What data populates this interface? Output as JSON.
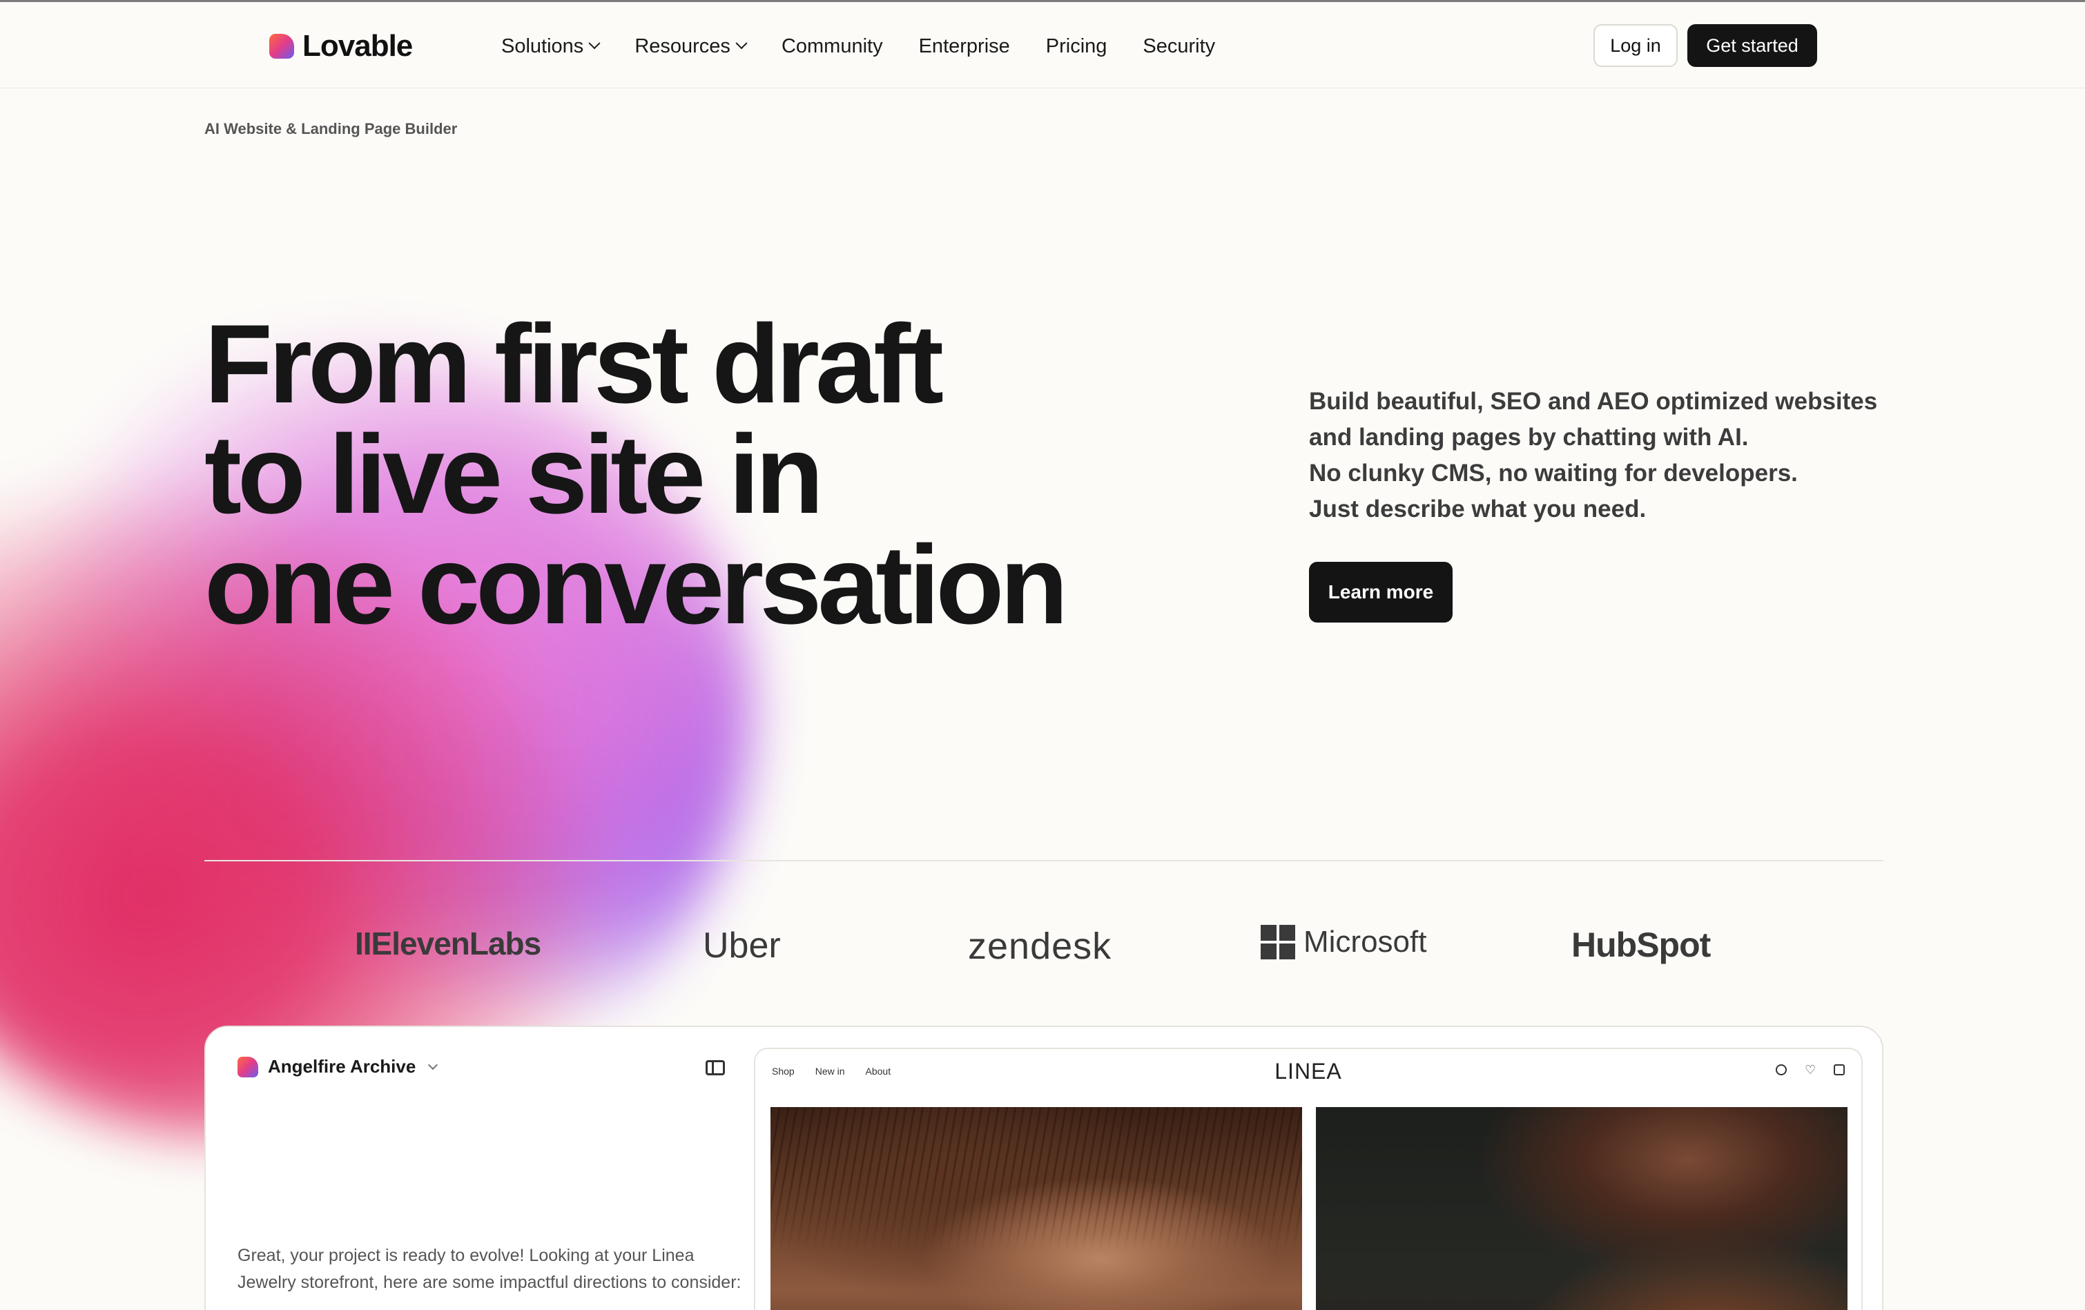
{
  "brand": {
    "name": "Lovable"
  },
  "nav": {
    "items": [
      {
        "label": "Solutions",
        "has_dropdown": true
      },
      {
        "label": "Resources",
        "has_dropdown": true
      },
      {
        "label": "Community",
        "has_dropdown": false
      },
      {
        "label": "Enterprise",
        "has_dropdown": false
      },
      {
        "label": "Pricing",
        "has_dropdown": false
      },
      {
        "label": "Security",
        "has_dropdown": false
      }
    ],
    "login_label": "Log in",
    "get_started_label": "Get started"
  },
  "hero": {
    "eyebrow": "AI Website & Landing Page Builder",
    "headline_lines": [
      "From first draft",
      "to live site in",
      "one conversation"
    ],
    "description_lines": [
      "Build beautiful, SEO and AEO optimized websites",
      "and landing pages by chatting with AI.",
      "No clunky CMS, no waiting for developers.",
      "Just describe what you need."
    ],
    "cta_label": "Learn more"
  },
  "logos": [
    "IIElevenLabs",
    "Uber",
    "zendesk",
    "Microsoft",
    "HubSpot"
  ],
  "preview": {
    "project_name": "Angelfire Archive",
    "chat_message": "Great, your project is ready to evolve! Looking at your Linea Jewelry storefront, here are some impactful directions to consider:",
    "site": {
      "brand": "LINEA",
      "nav": [
        "Shop",
        "New in",
        "About"
      ]
    }
  },
  "colors": {
    "background": "#fcfbf8",
    "primary_button": "#141414",
    "text": "#161616"
  }
}
